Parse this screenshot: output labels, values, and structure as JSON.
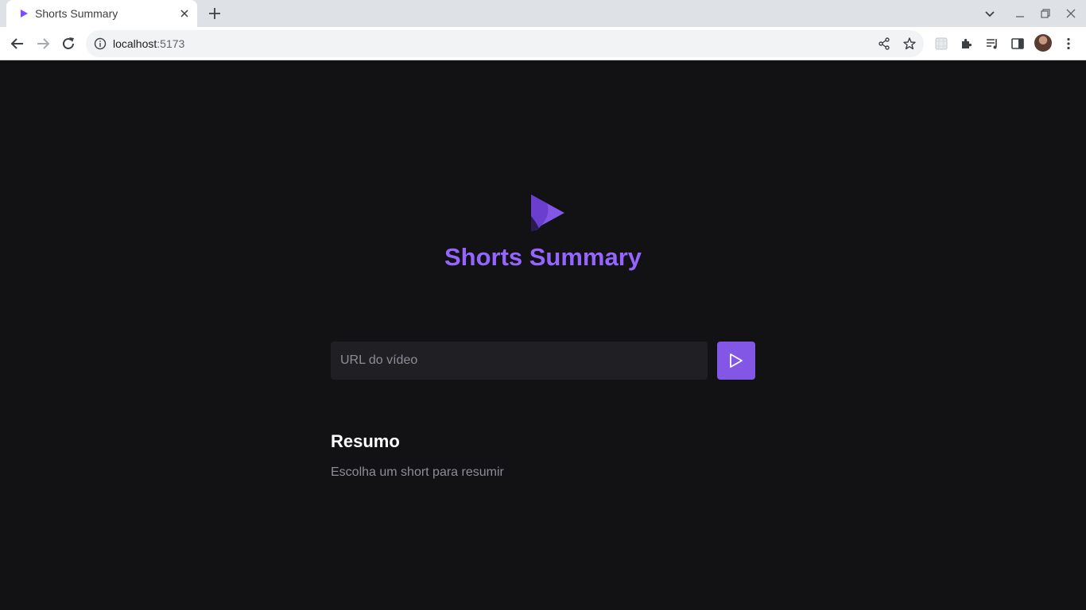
{
  "browser": {
    "tab": {
      "title": "Shorts Summary"
    },
    "address_bar": {
      "host": "localhost",
      "port": ":5173"
    },
    "icons": [
      "tab-favicon",
      "close-icon",
      "plus-icon",
      "chevron-down-icon",
      "minimize-icon",
      "restore-icon",
      "window-close-icon",
      "back-arrow-icon",
      "forward-arrow-icon",
      "reload-icon",
      "info-icon",
      "share-icon",
      "star-icon",
      "extension-grid-icon",
      "puzzle-icon",
      "reading-list-icon",
      "side-panel-icon",
      "avatar",
      "kebab-menu-icon"
    ]
  },
  "app": {
    "title": "Shorts Summary",
    "url_input": {
      "placeholder": "URL do vídeo",
      "value": ""
    },
    "submit_icon": "play-icon",
    "summary": {
      "heading": "Resumo",
      "text": "Escolha um short para resumir"
    }
  },
  "colors": {
    "background": "#121214",
    "accent": "#8257e5",
    "title": "#9466ff",
    "input_bg": "#202024",
    "muted_text": "#8d8d99"
  }
}
